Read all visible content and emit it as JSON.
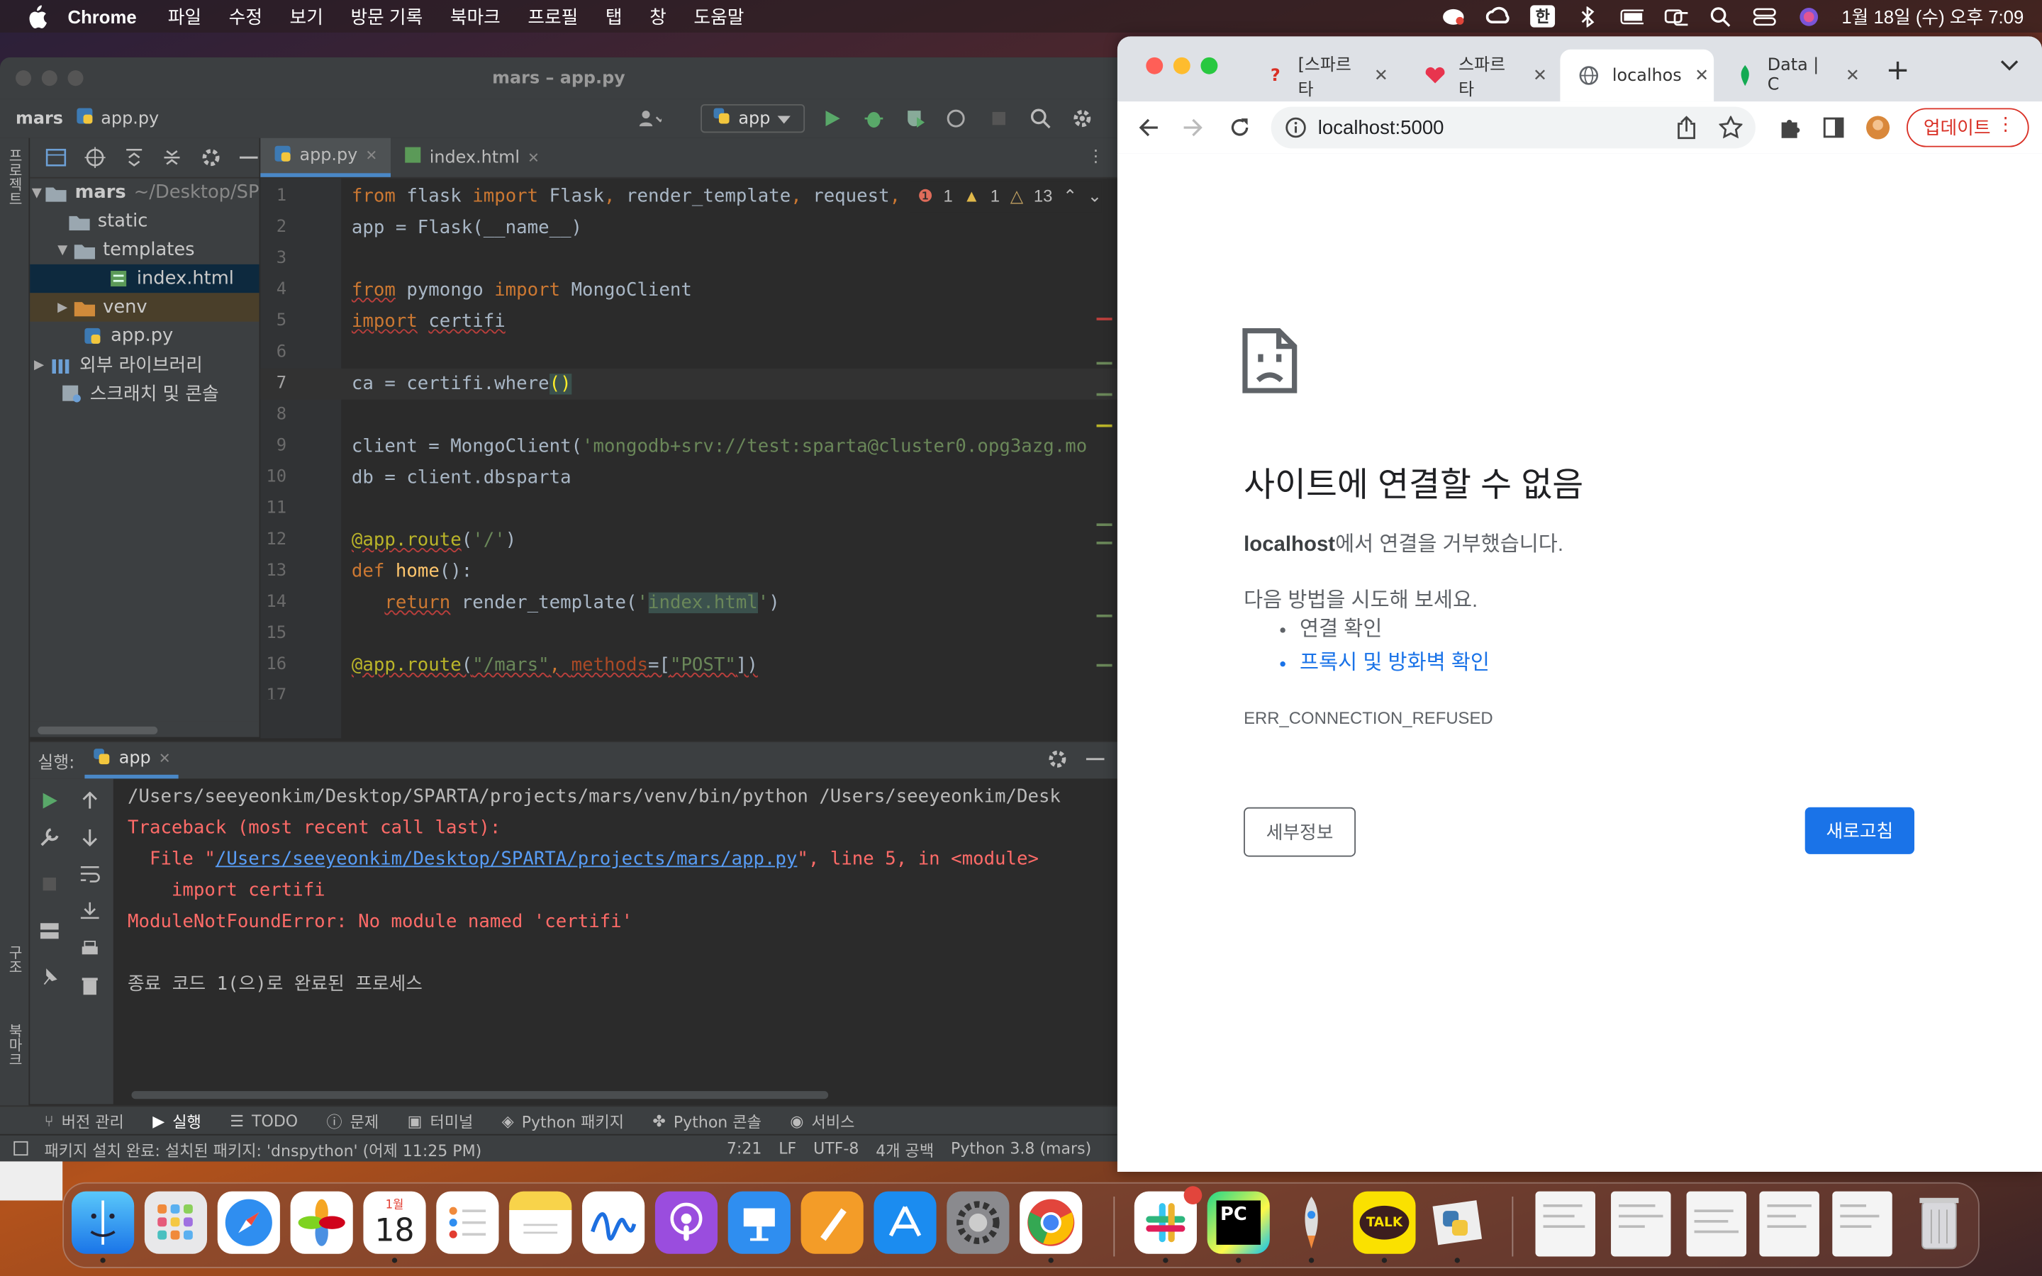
{
  "menubar": {
    "app": "Chrome",
    "items": [
      "파일",
      "수정",
      "보기",
      "방문 기록",
      "북마크",
      "프로필",
      "탭",
      "창",
      "도움말"
    ],
    "ime": "한",
    "datetime": "1월 18일 (수) 오후 7:09"
  },
  "ide": {
    "window_title": "mars – app.py",
    "breadcrumb_project": "mars",
    "breadcrumb_file": "app.py",
    "run_config": "app",
    "left_tab_project": "프로젝트",
    "left_tab_structure": "구조",
    "left_tab_bookmarks": "북마크",
    "tree": {
      "root": "mars",
      "root_path": "~/Desktop/SP",
      "static": "static",
      "templates": "templates",
      "index": "index.html",
      "venv": "venv",
      "app": "app.py",
      "external": "외부 라이브러리",
      "scratch": "스크래치 및 콘솔"
    },
    "tabs": [
      "app.py",
      "index.html"
    ],
    "inspections": {
      "errors": "1",
      "warnings": "1",
      "weak": "13"
    },
    "run": {
      "label": "실행:",
      "tab": "app",
      "lines": {
        "cmd": "/Users/seeyeonkim/Desktop/SPARTA/projects/mars/venv/bin/python /Users/seeyeonkim/Desk",
        "traceback": "Traceback (most recent call last):",
        "file_prefix": "  File \"",
        "file_link": "/Users/seeyeonkim/Desktop/SPARTA/projects/mars/app.py",
        "file_suffix": "\", line 5, in <module>",
        "import": "    import certifi",
        "error": "ModuleNotFoundError: No module named 'certifi'",
        "exit": "종료 코드 1(으)로 완료된 프로세스"
      }
    },
    "bottom_tabs": {
      "vcs": "버전 관리",
      "run": "실행",
      "todo": "TODO",
      "problems": "문제",
      "terminal": "터미널",
      "packages": "Python 패키지",
      "console": "Python 콘솔",
      "services": "서비스"
    },
    "status": {
      "message": "패키지 설치 완료: 설치된 패키지: 'dnspython' (어제 11:25 PM)",
      "position": "7:21",
      "line_sep": "LF",
      "encoding": "UTF-8",
      "indent": "4개 공백",
      "interpreter": "Python 3.8 (mars)"
    }
  },
  "chrome": {
    "tabs": [
      {
        "title": "[스파르타",
        "active": false
      },
      {
        "title": "스파르타",
        "active": false
      },
      {
        "title": "localhos",
        "active": true
      },
      {
        "title": "Data | C",
        "active": false
      }
    ],
    "url": "localhost:5000",
    "update_label": "업데이트",
    "error": {
      "title": "사이트에 연결할 수 없음",
      "host": "localhost",
      "desc_suffix": "에서 연결을 거부했습니다.",
      "try": "다음 방법을 시도해 보세요.",
      "suggestion1": "연결 확인",
      "suggestion2": "프록시 및 방화벽 확인",
      "code": "ERR_CONNECTION_REFUSED",
      "details_btn": "세부정보",
      "reload_btn": "새로고침"
    }
  },
  "dock": {
    "calendar_month": "1월",
    "calendar_day": "18",
    "pycharm_label": "PC",
    "kakao_label": "TALK"
  },
  "colors": {
    "ide_bg": "#2b2b2b",
    "keyword": "#cc7832",
    "string": "#6a8759",
    "error_text": "#ff6b68",
    "chrome_blue": "#1a73e8",
    "update_red": "#d93025"
  }
}
